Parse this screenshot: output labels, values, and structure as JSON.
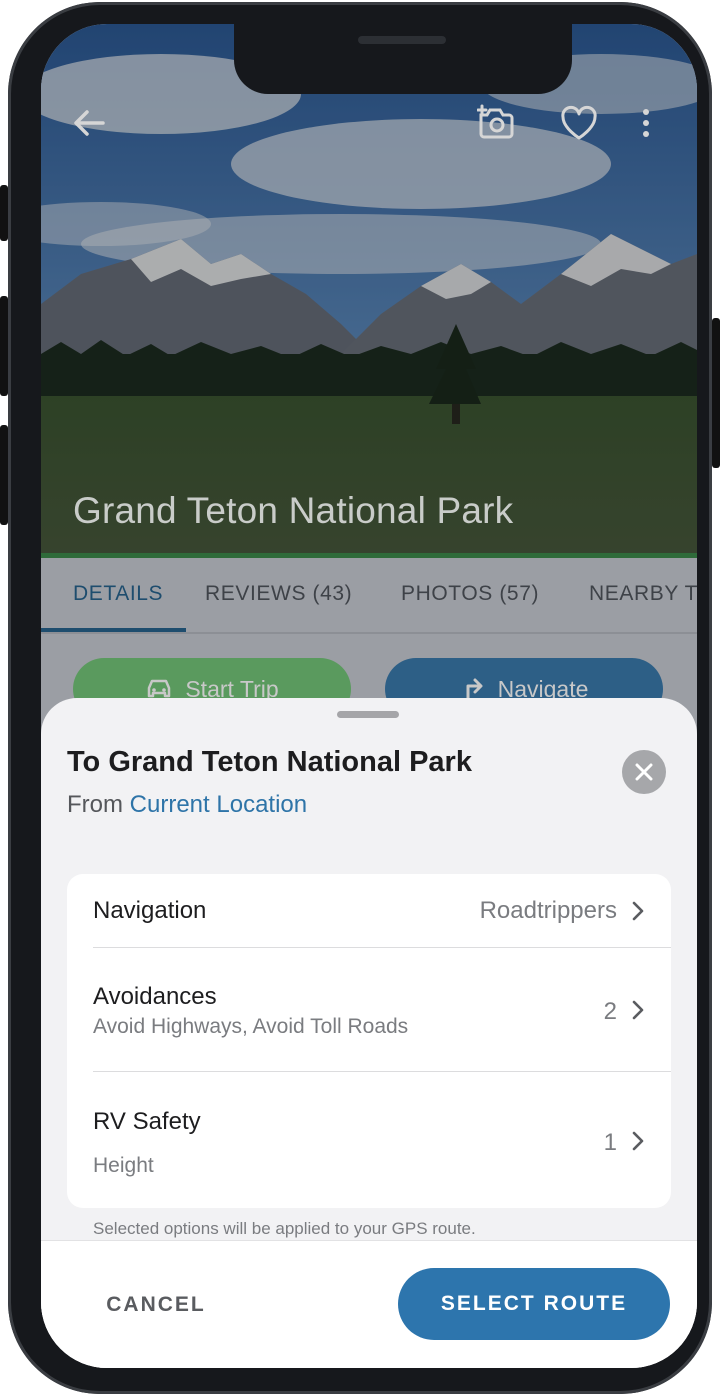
{
  "park": {
    "title": "Grand Teton National Park"
  },
  "topbar": {
    "back_icon": "back-arrow-icon",
    "camera_icon": "add-photo-icon",
    "favorite_icon": "heart-icon",
    "more_icon": "more-vertical-icon"
  },
  "tabs": [
    {
      "label": "DETAILS",
      "active": true
    },
    {
      "label": "REVIEWS (43)",
      "active": false
    },
    {
      "label": "PHOTOS (57)",
      "active": false
    },
    {
      "label": "NEARBY T",
      "active": false
    }
  ],
  "actions": {
    "start_trip": "Start Trip",
    "navigate": "Navigate"
  },
  "sheet": {
    "title": "To Grand Teton National Park",
    "from_prefix": "From ",
    "from_location": "Current Location",
    "rows": [
      {
        "label": "Navigation",
        "sub": "",
        "value": "Roadtrippers"
      },
      {
        "label": "Avoidances",
        "sub": "Avoid Highways, Avoid Toll Roads",
        "value": "2"
      },
      {
        "label": "RV Safety",
        "sub": "Height",
        "value": "1"
      }
    ],
    "footnote": "Selected options will be applied to your GPS route.",
    "cancel_label": "CANCEL",
    "select_label": "SELECT ROUTE"
  },
  "colors": {
    "accent": "#2d75ad",
    "link": "#2e74a8",
    "tab_active": "#1e4d6e",
    "start_trip": "#5a9a5e"
  }
}
